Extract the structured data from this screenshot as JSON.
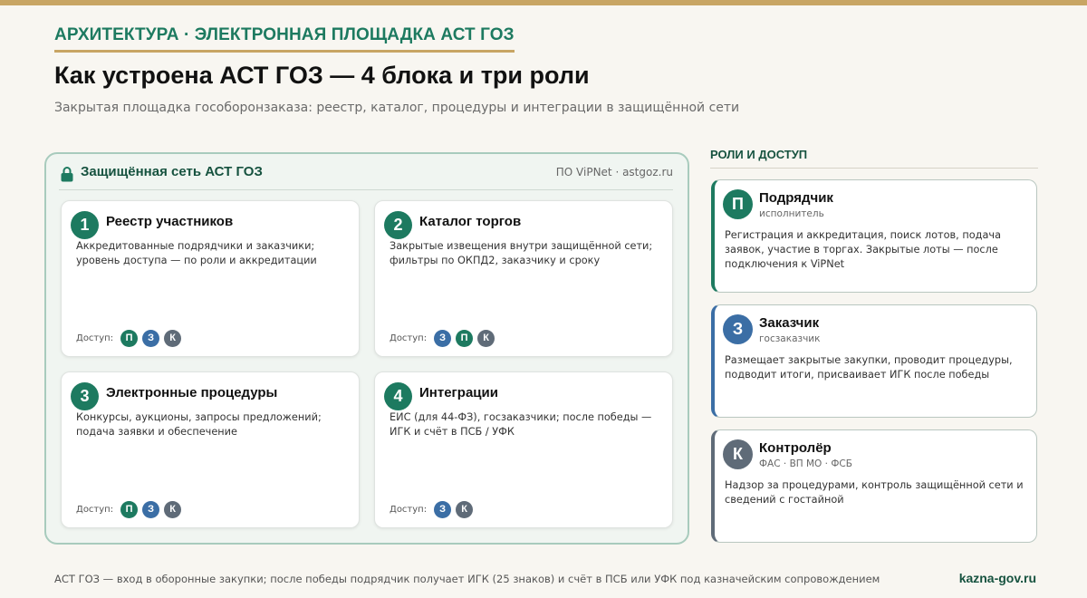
{
  "header": {
    "kicker": "АРХИТЕКТУРА · ЭЛЕКТРОННАЯ ПЛОЩАДКА АСТ ГОЗ",
    "title": "Как устроена АСТ ГОЗ — 4 блока и три роли",
    "subtitle": "Закрытая площадка гособоронзаказа: реестр, каталог, процедуры и интеграции в защищённой сети"
  },
  "network": {
    "title": "Защищённая сеть АСТ ГОЗ",
    "meta": "ПО ViPNet · astgoz.ru",
    "icon": "lock-icon",
    "access_label": "Доступ:",
    "blocks": [
      {
        "num": "1",
        "title": "Реестр участников",
        "desc": "Аккредитованные подрядчики и заказчики; уровень доступа — по роли и аккредитации",
        "access": [
          {
            "letter": "П",
            "color": "#1d7a60"
          },
          {
            "letter": "З",
            "color": "#3b6ea5"
          },
          {
            "letter": "К",
            "color": "#5f6b78"
          }
        ]
      },
      {
        "num": "2",
        "title": "Каталог торгов",
        "desc": "Закрытые извещения внутри защищённой сети; фильтры по ОКПД2, заказчику и сроку",
        "access": [
          {
            "letter": "З",
            "color": "#3b6ea5"
          },
          {
            "letter": "П",
            "color": "#1d7a60"
          },
          {
            "letter": "К",
            "color": "#5f6b78"
          }
        ]
      },
      {
        "num": "3",
        "title": "Электронные процедуры",
        "desc": "Конкурсы, аукционы, запросы предложений; подача заявки и обеспечение",
        "access": [
          {
            "letter": "П",
            "color": "#1d7a60"
          },
          {
            "letter": "З",
            "color": "#3b6ea5"
          },
          {
            "letter": "К",
            "color": "#5f6b78"
          }
        ]
      },
      {
        "num": "4",
        "title": "Интеграции",
        "desc": "ЕИС (для 44-ФЗ), госзаказчики; после победы — ИГК и счёт в ПСБ / УФК",
        "access": [
          {
            "letter": "З",
            "color": "#3b6ea5"
          },
          {
            "letter": "К",
            "color": "#5f6b78"
          }
        ]
      }
    ]
  },
  "roles": {
    "title": "РОЛИ И ДОСТУП",
    "items": [
      {
        "letter": "П",
        "color": "#1d7a60",
        "name": "Подрядчик",
        "sub": "исполнитель",
        "desc": "Регистрация и аккредитация, поиск лотов, подача заявок, участие в торгах. Закрытые лоты — после подключения к ViPNet"
      },
      {
        "letter": "З",
        "color": "#3b6ea5",
        "name": "Заказчик",
        "sub": "госзаказчик",
        "desc": "Размещает закрытые закупки, проводит процедуры, подводит итоги, присваивает ИГК после победы"
      },
      {
        "letter": "К",
        "color": "#5f6b78",
        "name": "Контролёр",
        "sub": "ФАС · ВП МО · ФСБ",
        "desc": "Надзор за процедурами, контроль защищённой сети и сведений с гостайной"
      }
    ]
  },
  "footer": {
    "note": "АСТ ГОЗ — вход в оборонные закупки; после победы подрядчик получает ИГК (25 знаков) и счёт в ПСБ или УФК под казначейским сопровождением",
    "brand": "kazna-gov.ru"
  }
}
